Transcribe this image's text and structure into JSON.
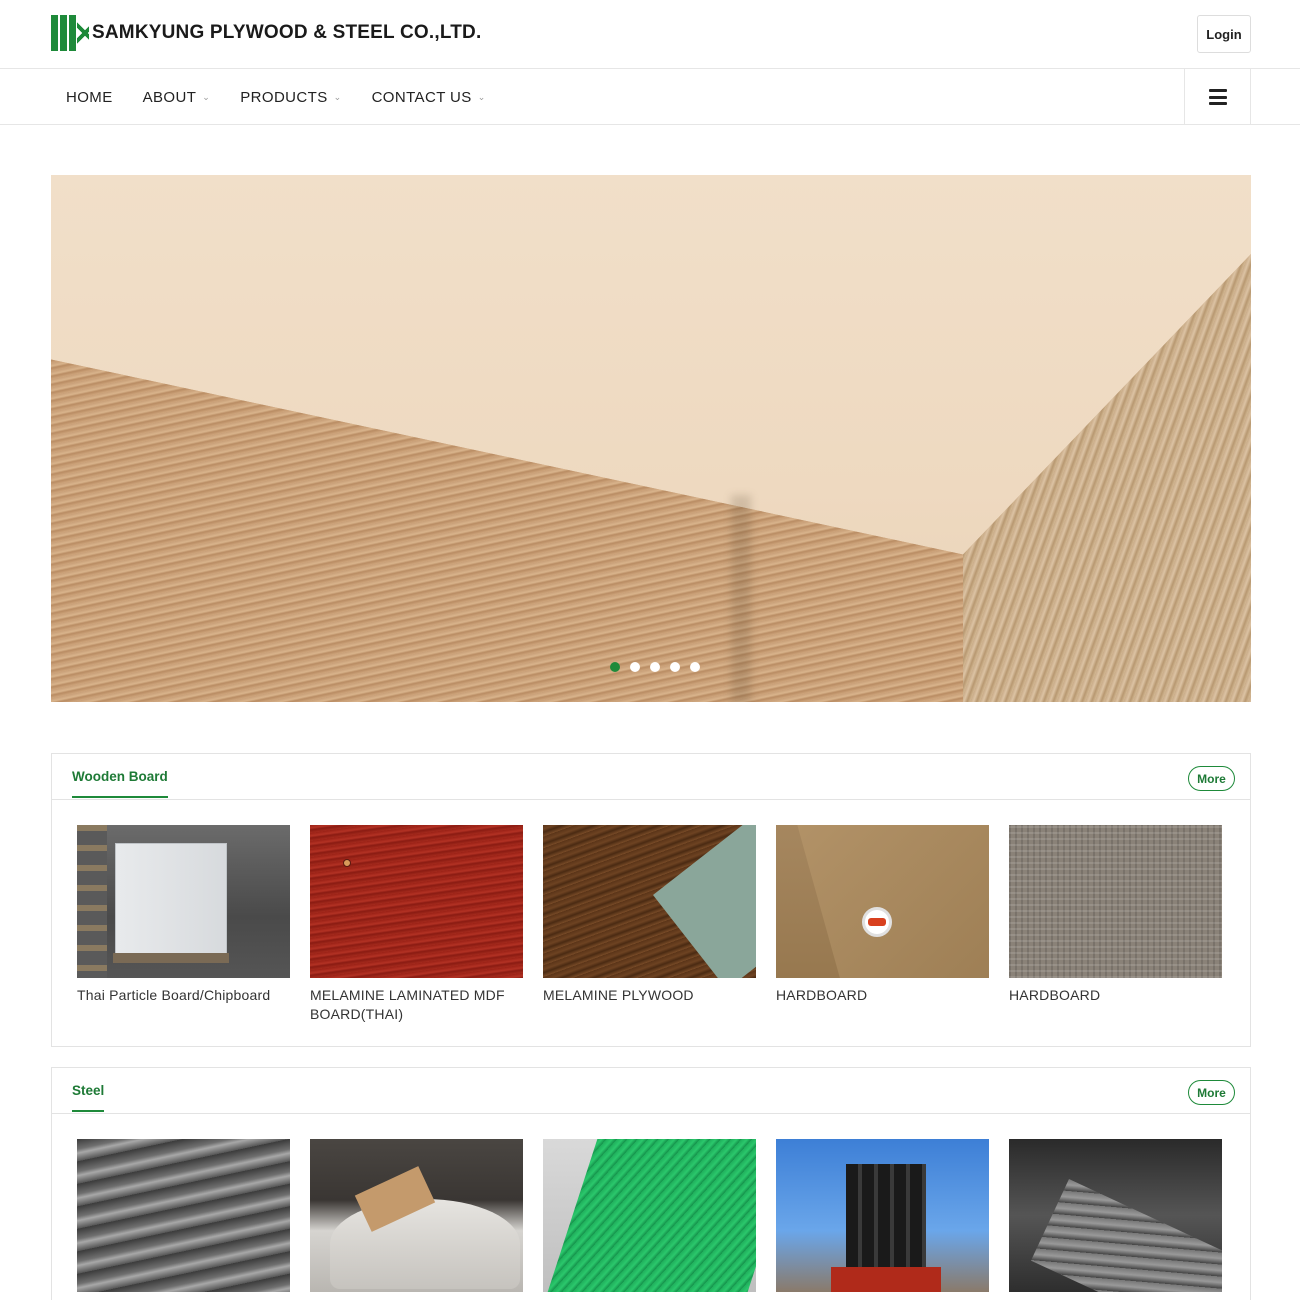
{
  "header": {
    "company_name": "SAMKYUNG PLYWOOD & STEEL CO.,LTD.",
    "login_label": "Login"
  },
  "nav": {
    "items": [
      {
        "label": "HOME",
        "has_dropdown": false
      },
      {
        "label": "ABOUT",
        "has_dropdown": true
      },
      {
        "label": "PRODUCTS",
        "has_dropdown": true
      },
      {
        "label": "CONTACT US",
        "has_dropdown": true
      }
    ],
    "menu_icon": "hamburger-icon"
  },
  "hero": {
    "slide_count": 5,
    "active_slide": 1
  },
  "sections": [
    {
      "title": "Wooden Board",
      "more_label": "More",
      "products": [
        {
          "name": "Thai Particle Board/Chipboard"
        },
        {
          "name": "MELAMINE LAMINATED MDF BOARD(THAI)"
        },
        {
          "name": "MELAMINE PLYWOOD"
        },
        {
          "name": "HARDBOARD"
        },
        {
          "name": "HARDBOARD"
        }
      ]
    },
    {
      "title": "Steel",
      "more_label": "More",
      "products": [
        {
          "name": ""
        },
        {
          "name": ""
        },
        {
          "name": ""
        },
        {
          "name": ""
        },
        {
          "name": ""
        }
      ]
    }
  ],
  "colors": {
    "brand_green": "#1e8a3a",
    "text_dark": "#222222",
    "border": "#e3e3e3"
  }
}
